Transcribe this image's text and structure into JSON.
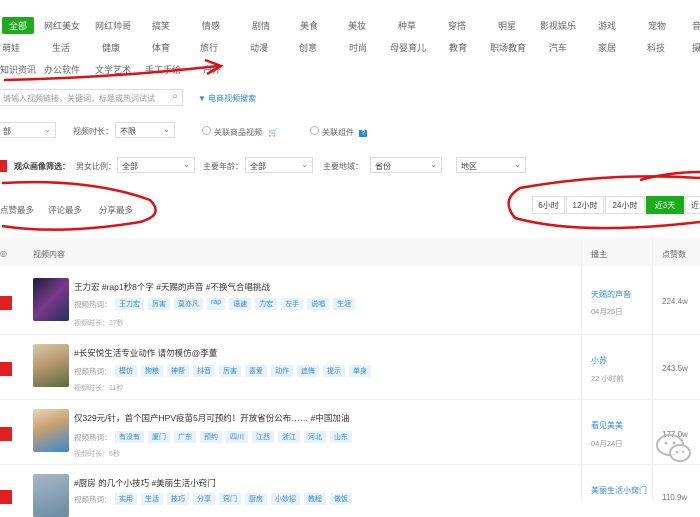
{
  "categories": {
    "row1": [
      "全部",
      "网红美女",
      "网红帅哥",
      "搞笑",
      "情感",
      "剧情",
      "美食",
      "美妆",
      "种草",
      "穿搭",
      "明星",
      "影视娱乐",
      "游戏",
      "宠物",
      "音"
    ],
    "row2": [
      "萌娃",
      "生活",
      "健康",
      "体育",
      "旅行",
      "动漫",
      "创意",
      "时尚",
      "母婴育儿",
      "教育",
      "职场教育",
      "汽车",
      "家居",
      "科技",
      "摄"
    ],
    "row3": [
      "知识资讯",
      "办公软件",
      "文学艺术",
      "手工手绘",
      "户外"
    ]
  },
  "search": {
    "placeholder": "请输入视频链接，关键词，标题或热词试试",
    "icon": "search-icon",
    "ecommerce_link": "电商视频搜索"
  },
  "filters": {
    "first_select": "部",
    "duration_label": "视频时长：",
    "duration_value": "不限",
    "linked_goods": "关联商品视频",
    "linked_component": "关联组件",
    "audience_label": "观众画像筛选：",
    "gender_label": "男女比例：",
    "gender_value": "全部",
    "age_label": "主要年龄：",
    "age_value": "全部",
    "region_label": "主要地域：",
    "province_value": "省份",
    "city_value": "地区"
  },
  "sort": {
    "options": [
      "点赞最多",
      "评论最多",
      "分享最多"
    ]
  },
  "time_range": {
    "options": [
      "6小时",
      "12小时",
      "24小时",
      "近3天",
      "近"
    ],
    "active_index": 3
  },
  "table": {
    "headers": {
      "col0": "◎",
      "content": "视频内容",
      "author": "播主",
      "likes": "点赞数"
    },
    "hot_label": "视频热词：",
    "rows": [
      {
        "title": "王力宏 #rap1秒8个字 #天赐的声音 #不换气合唱挑战",
        "tags": [
          "王力宏",
          "厉害",
          "莫亦凡",
          "rap",
          "语速",
          "力宏",
          "左手",
          "说唱",
          "生涯"
        ],
        "duration": "视频时长：27秒",
        "author": "天赐的声音",
        "date": "04月25日",
        "likes": "224.4w"
      },
      {
        "title": "#长安悦生活专业动作 请勿模仿@李董",
        "tags": [
          "模仿",
          "狗粮",
          "神帮",
          "抖音",
          "厉害",
          "喜爱",
          "动作",
          "追悔",
          "提示",
          "单身"
        ],
        "duration": "视频时长：11秒",
        "author": "小苏",
        "date": "22 小时前",
        "likes": "243.5w"
      },
      {
        "title": "仅329元/针，首个国产HPV疫苗5月可预约！开放省份公布…… #中国加油",
        "tags": [
          "有没有",
          "厦门",
          "广东",
          "预约",
          "四川",
          "江西",
          "浙江",
          "河北",
          "山东"
        ],
        "duration": "视频时长：6秒",
        "author": "看见美美",
        "date": "04月24日",
        "likes": "177.0w"
      },
      {
        "title": "#厨房 的几个小技巧 #美丽生活小窍门",
        "tags": [
          "实用",
          "生活",
          "技巧",
          "分享",
          "窍门",
          "厨房",
          "小妙招",
          "教程",
          "做饭"
        ],
        "duration": "",
        "author": "美丽生活小窍门",
        "date": "",
        "likes": "110.9w"
      }
    ]
  },
  "colors": {
    "accent_green": "#1aad19",
    "link_blue": "#2a8be0",
    "annotation_red": "#e01010"
  }
}
